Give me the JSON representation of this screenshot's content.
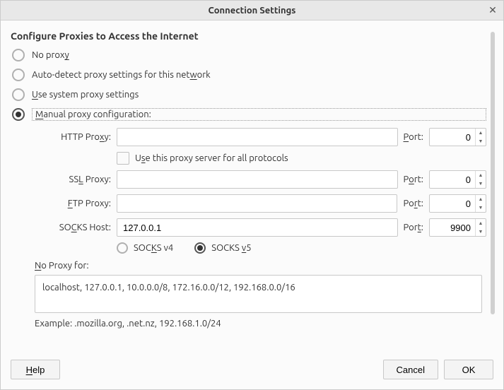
{
  "window": {
    "title": "Connection Settings"
  },
  "heading": "Configure Proxies to Access the Internet",
  "radios": {
    "noProxy": {
      "pre": "No prox",
      "u": "y",
      "post": ""
    },
    "autoDetect": {
      "pre": "Auto-detect proxy settings for this net",
      "u": "w",
      "post": "ork"
    },
    "system": {
      "pre": "",
      "u": "U",
      "post": "se system proxy settings"
    },
    "manual": {
      "pre": "",
      "u": "M",
      "post": "anual proxy configuration:"
    }
  },
  "fields": {
    "http": {
      "labelPre": "HTTP Pro",
      "labelU": "x",
      "labelPost": "y:",
      "value": "",
      "portLabelU": "P",
      "portLabelPost": "ort:",
      "port": "0"
    },
    "useAll": {
      "pre": "U",
      "u": "s",
      "post": "e this proxy server for all protocols"
    },
    "ssl": {
      "labelPre": "SS",
      "labelU": "L",
      "labelPost": " Proxy:",
      "value": "",
      "portLabelPre": "P",
      "portLabelU": "o",
      "portLabelPost": "rt:",
      "port": "0"
    },
    "ftp": {
      "labelPre": "",
      "labelU": "F",
      "labelPost": "TP Proxy:",
      "value": "",
      "portLabelPre": "Po",
      "portLabelU": "r",
      "portLabelPost": "t:",
      "port": "0"
    },
    "socks": {
      "labelPre": "SO",
      "labelU": "C",
      "labelPost": "KS Host:",
      "value": "127.0.0.1",
      "portLabelPre": "Por",
      "portLabelU": "t",
      "portLabelPost": ":",
      "port": "9900"
    },
    "socksv4": {
      "pre": "SOC",
      "u": "K",
      "post": "S v4"
    },
    "socksv5": {
      "pre": "SOCKS ",
      "u": "v",
      "post": "5"
    },
    "noProxyFor": {
      "labelU": "N",
      "labelPost": "o Proxy for:",
      "value": "localhost, 127.0.0.1, 10.0.0.0/8, 172.16.0.0/12, 192.168.0.0/16"
    },
    "example": "Example: .mozilla.org, .net.nz, 192.168.1.0/24"
  },
  "buttons": {
    "help": {
      "u": "H",
      "post": "elp"
    },
    "cancel": "Cancel",
    "ok": "OK"
  }
}
